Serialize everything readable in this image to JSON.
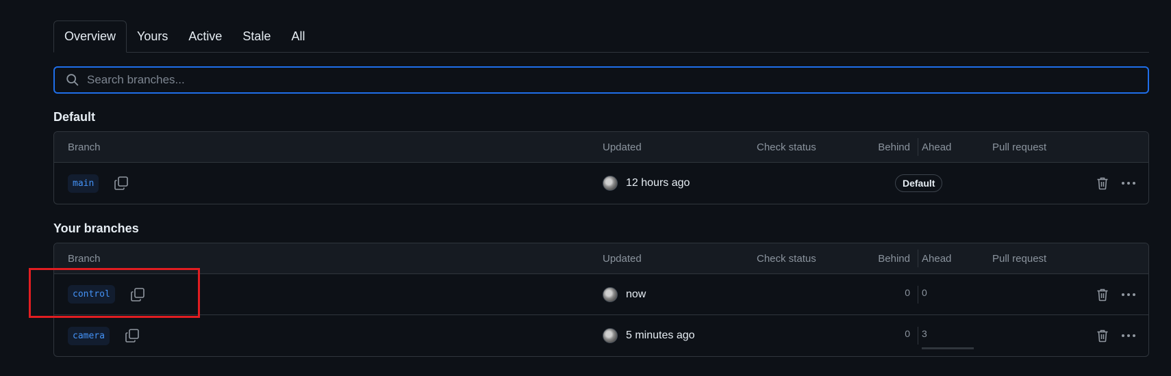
{
  "tabs": [
    {
      "label": "Overview",
      "active": true
    },
    {
      "label": "Yours",
      "active": false
    },
    {
      "label": "Active",
      "active": false
    },
    {
      "label": "Stale",
      "active": false
    },
    {
      "label": "All",
      "active": false
    }
  ],
  "search": {
    "placeholder": "Search branches...",
    "value": "",
    "icon": "search-icon"
  },
  "sections": {
    "default_title": "Default",
    "yours_title": "Your branches"
  },
  "columns": {
    "branch": "Branch",
    "updated": "Updated",
    "check_status": "Check status",
    "behind": "Behind",
    "ahead": "Ahead",
    "pull_request": "Pull request"
  },
  "default_branches": [
    {
      "name": "main",
      "updated": "12 hours ago",
      "badge": "Default"
    }
  ],
  "your_branches": [
    {
      "name": "control",
      "updated": "now",
      "behind": "0",
      "ahead": "0"
    },
    {
      "name": "camera",
      "updated": "5 minutes ago",
      "behind": "0",
      "ahead": "3"
    }
  ],
  "colors": {
    "background": "#0d1117",
    "accent_blue": "#1f6feb",
    "branch_text": "#4493f8",
    "highlight_red": "#e11d21"
  }
}
